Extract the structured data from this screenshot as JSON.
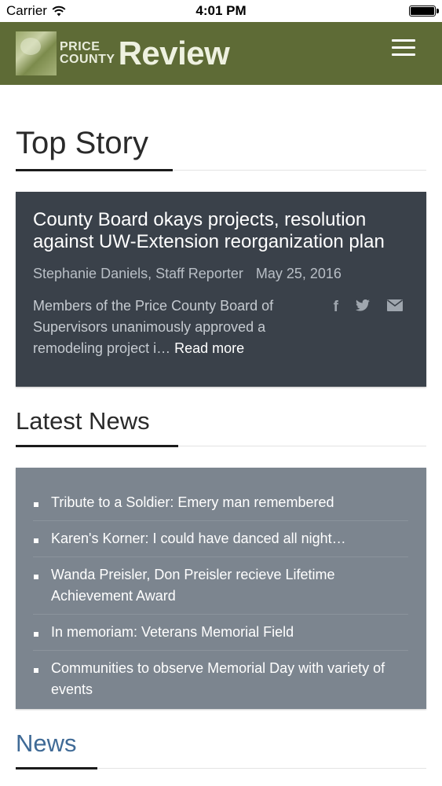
{
  "status_bar": {
    "carrier": "Carrier",
    "time": "4:01 PM"
  },
  "header": {
    "logo_line1": "PRICE",
    "logo_line2": "COUNTY",
    "logo_main": "Review",
    "brand_color": "#5e6b36",
    "menu_icon": "hamburger-menu-icon"
  },
  "top_story": {
    "section_title": "Top Story",
    "headline": "County Board okays projects, resolution against UW-Extension reorganization plan",
    "author": "Stephanie Daniels, Staff Reporter",
    "date": "May 25, 2016",
    "summary": "Members of the Price County Board of Supervisors unanimously approved a remodeling project i…",
    "read_more": "Read more",
    "share_icons": [
      "facebook-icon",
      "twitter-icon",
      "email-icon"
    ],
    "card_color": "#3a414a"
  },
  "latest_news": {
    "section_title": "Latest News",
    "items": [
      "Tribute to a Soldier: Emery man remembered",
      "Karen's Korner: I could have danced all night…",
      "Wanda Preisler, Don Preisler recieve Lifetime Achievement Award",
      "In memoriam: Veterans Memorial Field",
      "Communities to observe Memorial Day with variety of events"
    ],
    "box_color": "#7c858f"
  },
  "news": {
    "section_title": "News",
    "title_color": "#3f6a96"
  }
}
